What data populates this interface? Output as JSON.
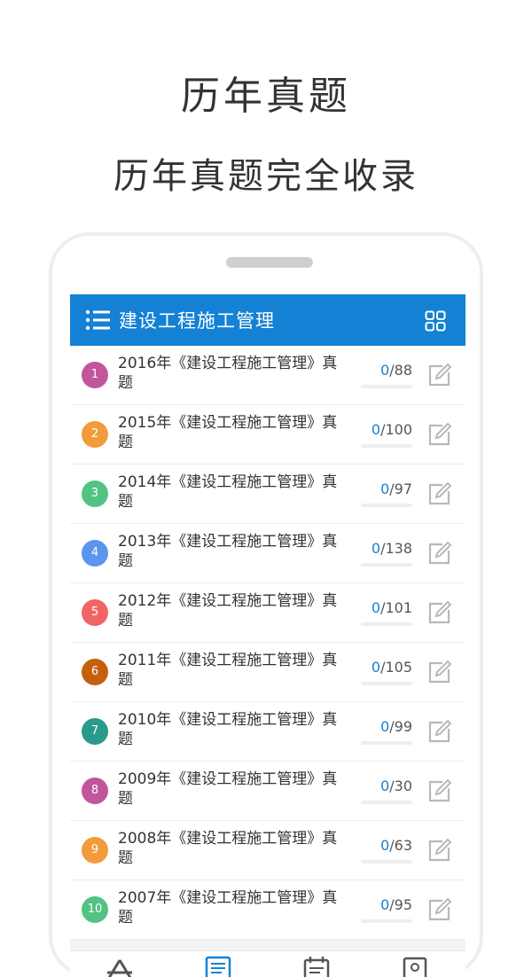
{
  "header": {
    "title": "历年真题",
    "subtitle": "历年真题完全收录"
  },
  "app": {
    "title": "建设工程施工管理",
    "accent_color": "#1481d4"
  },
  "exams": [
    {
      "number": "1",
      "title": "2016年《建设工程施工管理》真题",
      "done": "0",
      "total": "/88",
      "color": "#c2569b"
    },
    {
      "number": "2",
      "title": "2015年《建设工程施工管理》真题",
      "done": "0",
      "total": "/100",
      "color": "#f29b3b"
    },
    {
      "number": "3",
      "title": "2014年《建设工程施工管理》真题",
      "done": "0",
      "total": "/97",
      "color": "#52c384"
    },
    {
      "number": "4",
      "title": "2013年《建设工程施工管理》真题",
      "done": "0",
      "total": "/138",
      "color": "#5b95ee"
    },
    {
      "number": "5",
      "title": "2012年《建设工程施工管理》真题",
      "done": "0",
      "total": "/101",
      "color": "#f26464"
    },
    {
      "number": "6",
      "title": "2011年《建设工程施工管理》真题",
      "done": "0",
      "total": "/105",
      "color": "#c3610d"
    },
    {
      "number": "7",
      "title": "2010年《建设工程施工管理》真题",
      "done": "0",
      "total": "/99",
      "color": "#2b9a8c"
    },
    {
      "number": "8",
      "title": "2009年《建设工程施工管理》真题",
      "done": "0",
      "total": "/30",
      "color": "#c2569b"
    },
    {
      "number": "9",
      "title": "2008年《建设工程施工管理》真题",
      "done": "0",
      "total": "/63",
      "color": "#f29b3b"
    },
    {
      "number": "10",
      "title": "2007年《建设工程施工管理》真题",
      "done": "0",
      "total": "/95",
      "color": "#52c384"
    }
  ],
  "tabs": [
    {
      "icon": "triangle-logo-icon"
    },
    {
      "icon": "document-icon"
    },
    {
      "icon": "calendar-icon"
    },
    {
      "icon": "book-icon"
    }
  ]
}
